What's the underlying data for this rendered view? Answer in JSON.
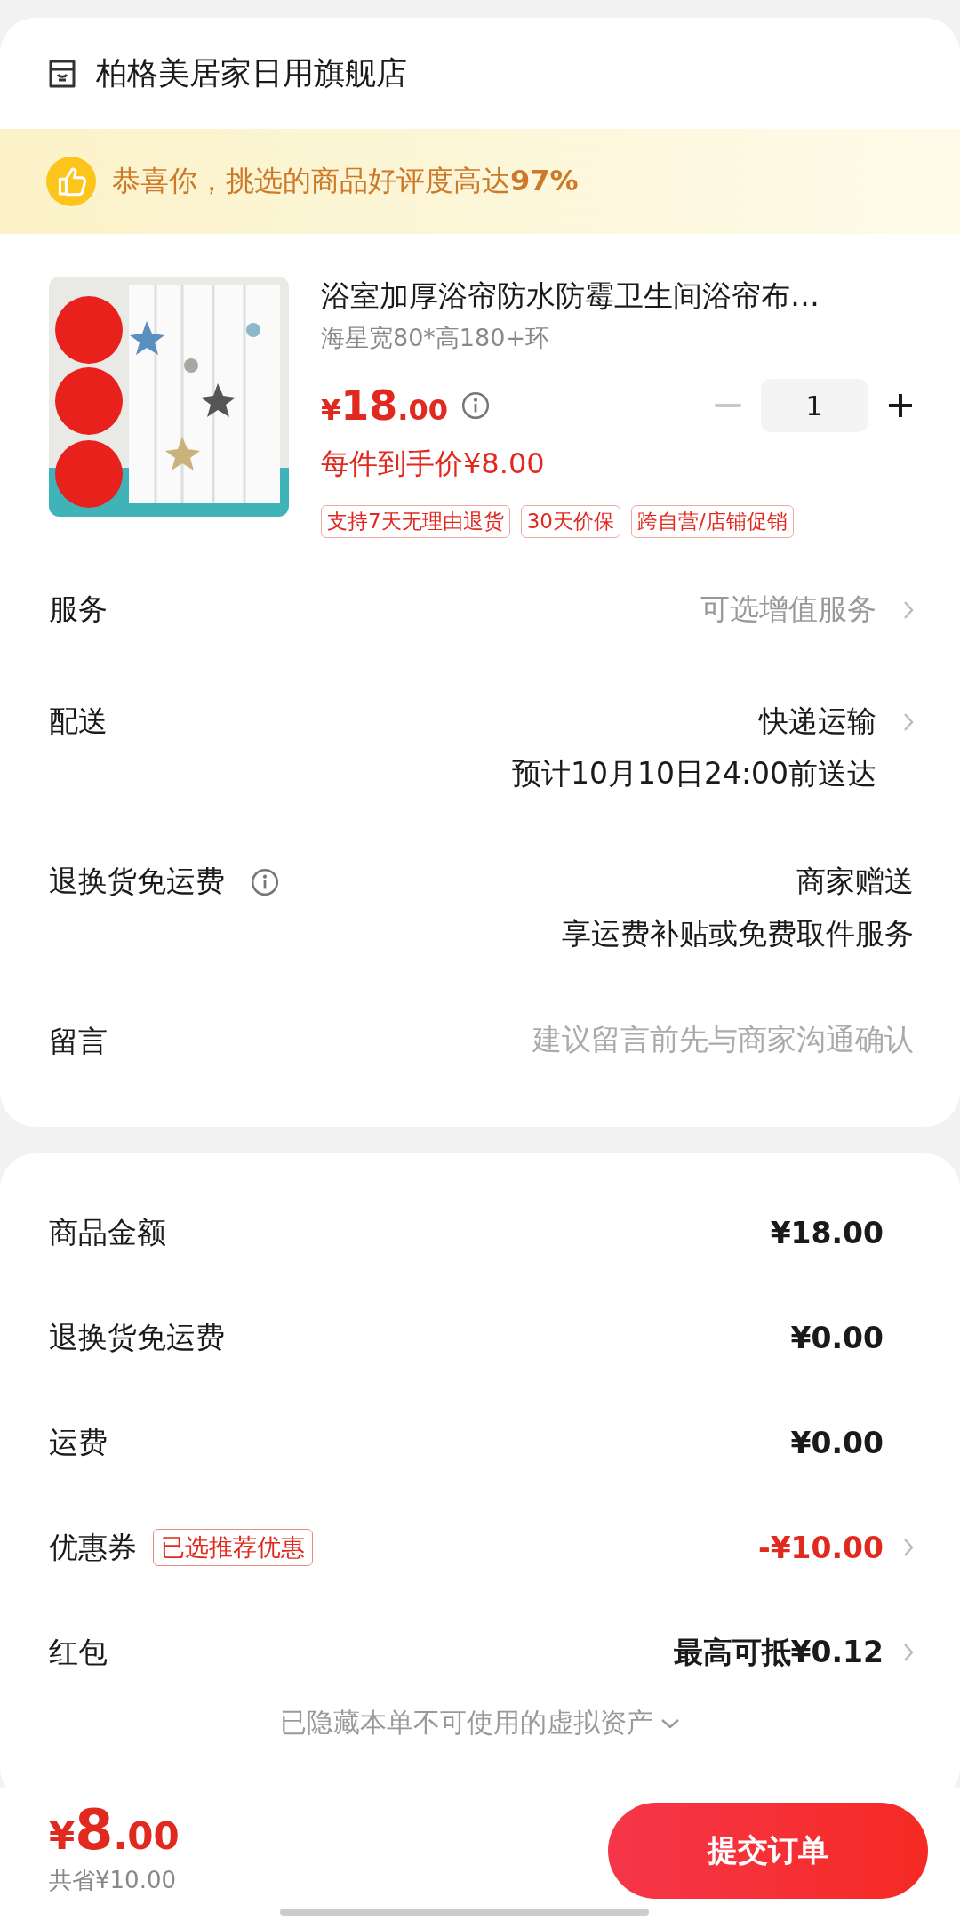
{
  "store": {
    "name": "柏格美居家日用旗舰店"
  },
  "banner": {
    "text": "恭喜你，挑选的商品好评度高达**97%**"
  },
  "product": {
    "image": {
      "kind": "picture"
    },
    "title": "浴室加厚浴帘防水防霉卫生间浴帘布…",
    "variant": "海星宽80*高180+环",
    "price": {
      "symbol": "¥",
      "whole": "18",
      "fraction": ".00"
    },
    "price_info": true,
    "final_price": "每件到手价¥8.00",
    "quantity": "1",
    "decrease_disabled": true,
    "tags": [
      "支持7天无理由退货",
      "30天价保",
      "跨自营/店铺促销"
    ]
  },
  "options": [
    {
      "label": "服务",
      "kind": "hint",
      "info": false,
      "chevron": true,
      "values": [
        "可选增值服务"
      ]
    },
    {
      "label": "配送",
      "kind": "text",
      "info": false,
      "chevron": true,
      "values": [
        "快递运输",
        "预计10月10日24:00前送达"
      ]
    },
    {
      "label": "退换货免运费",
      "kind": "text",
      "info": true,
      "chevron": false,
      "values": [
        "商家赠送",
        "享运费补贴或免费取件服务"
      ]
    },
    {
      "label": "留言",
      "kind": "input",
      "info": false,
      "chevron": false,
      "placeholder": "建议留言前先与商家沟通确认"
    }
  ],
  "summary": [
    {
      "label": "商品金额",
      "kind": "amount",
      "value": "¥18.00",
      "chevron": false
    },
    {
      "label": "退换货免运费",
      "kind": "amount",
      "value": "¥0.00",
      "chevron": false
    },
    {
      "label": "运费",
      "kind": "amount",
      "value": "¥0.00",
      "chevron": false
    },
    {
      "label": "优惠券",
      "kind": "discount",
      "badge": "已选推荐优惠",
      "value": "-¥10.00",
      "chevron": true
    },
    {
      "label": "红包",
      "kind": "amount",
      "value": "最高可抵¥0.12",
      "chevron": true
    }
  ],
  "hidden_assets": {
    "text": "已隐藏本单不可使用的虚拟资产"
  },
  "footer": {
    "total": {
      "symbol": "¥",
      "whole": "8",
      "fraction": ".00"
    },
    "saved": "共省¥10.00",
    "submit": "提交订单"
  }
}
